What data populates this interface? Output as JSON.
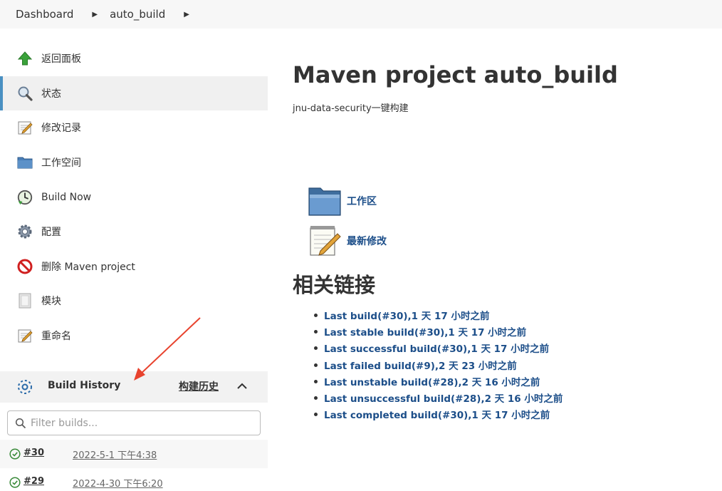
{
  "breadcrumb": {
    "items": [
      "Dashboard",
      "auto_build"
    ]
  },
  "sidebar": {
    "items": [
      {
        "label": "返回面板",
        "icon": "up-arrow-icon"
      },
      {
        "label": "状态",
        "icon": "search-icon"
      },
      {
        "label": "修改记录",
        "icon": "notepad-icon"
      },
      {
        "label": "工作空间",
        "icon": "folder-icon"
      },
      {
        "label": "Build Now",
        "icon": "clock-icon"
      },
      {
        "label": "配置",
        "icon": "gear-icon"
      },
      {
        "label": "删除 Maven project",
        "icon": "no-entry-icon"
      },
      {
        "label": "模块",
        "icon": "module-icon"
      },
      {
        "label": "重命名",
        "icon": "notepad-icon"
      }
    ]
  },
  "build_history": {
    "title": "Build History",
    "trend_label": "构建历史",
    "filter_placeholder": "Filter builds...",
    "builds": [
      {
        "number": "#30",
        "date": "2022-5-1 下午4:38",
        "status": "success"
      },
      {
        "number": "#29",
        "date": "2022-4-30 下午6:20",
        "status": "success"
      }
    ]
  },
  "main": {
    "title": "Maven project auto_build",
    "description": "jnu-data-security一键构建",
    "links": [
      {
        "label": "工作区",
        "icon": "folder-icon"
      },
      {
        "label": "最新修改",
        "icon": "notepad-icon"
      }
    ],
    "related_title": "相关链接",
    "permalinks": [
      "Last build(#30),1 天 17 小时之前",
      "Last stable build(#30),1 天 17 小时之前",
      "Last successful build(#30),1 天 17 小时之前",
      "Last failed build(#9),2 天 23 小时之前",
      "Last unstable build(#28),2 天 16 小时之前",
      "Last unsuccessful build(#28),2 天 16 小时之前",
      "Last completed build(#30),1 天 17 小时之前"
    ]
  },
  "colors": {
    "link": "#1c4e89",
    "active_accent": "#4a90c2",
    "success": "#3a8a3a",
    "annotation_arrow": "#e8432e"
  }
}
